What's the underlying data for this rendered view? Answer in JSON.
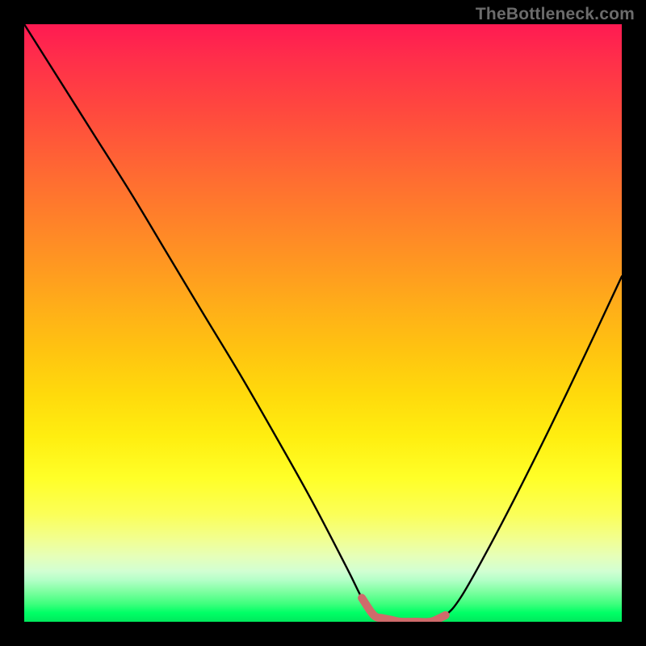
{
  "attribution": "TheBottleneck.com",
  "chart_data": {
    "type": "line",
    "title": "",
    "xlabel": "",
    "ylabel": "",
    "xlim": [
      0,
      1
    ],
    "ylim": [
      0,
      1
    ],
    "grid": false,
    "legend": false,
    "series": [
      {
        "name": "bottleneck-curve",
        "color": "#000000",
        "x": [
          0.0,
          0.06,
          0.12,
          0.18,
          0.24,
          0.3,
          0.36,
          0.42,
          0.48,
          0.54,
          0.565,
          0.585,
          0.63,
          0.68,
          0.705,
          0.73,
          0.77,
          0.82,
          0.88,
          0.94,
          1.0
        ],
        "values": [
          1.0,
          0.905,
          0.81,
          0.715,
          0.615,
          0.515,
          0.416,
          0.312,
          0.205,
          0.09,
          0.04,
          0.011,
          0.0,
          0.0,
          0.011,
          0.04,
          0.11,
          0.205,
          0.325,
          0.45,
          0.578
        ]
      },
      {
        "name": "optimal-segment",
        "color": "#d46a6a",
        "x": [
          0.565,
          0.585,
          0.6,
          0.615,
          0.63,
          0.655,
          0.68,
          0.695,
          0.705
        ],
        "values": [
          0.04,
          0.011,
          0.006,
          0.003,
          0.0,
          0.0,
          0.0,
          0.006,
          0.011
        ]
      }
    ],
    "background": {
      "type": "vertical-gradient",
      "stops": [
        {
          "pos": 0.0,
          "color": "#ff1a52"
        },
        {
          "pos": 0.48,
          "color": "#ffb018"
        },
        {
          "pos": 0.76,
          "color": "#ffff28"
        },
        {
          "pos": 0.92,
          "color": "#d2ffd2"
        },
        {
          "pos": 1.0,
          "color": "#00e85c"
        }
      ]
    }
  }
}
